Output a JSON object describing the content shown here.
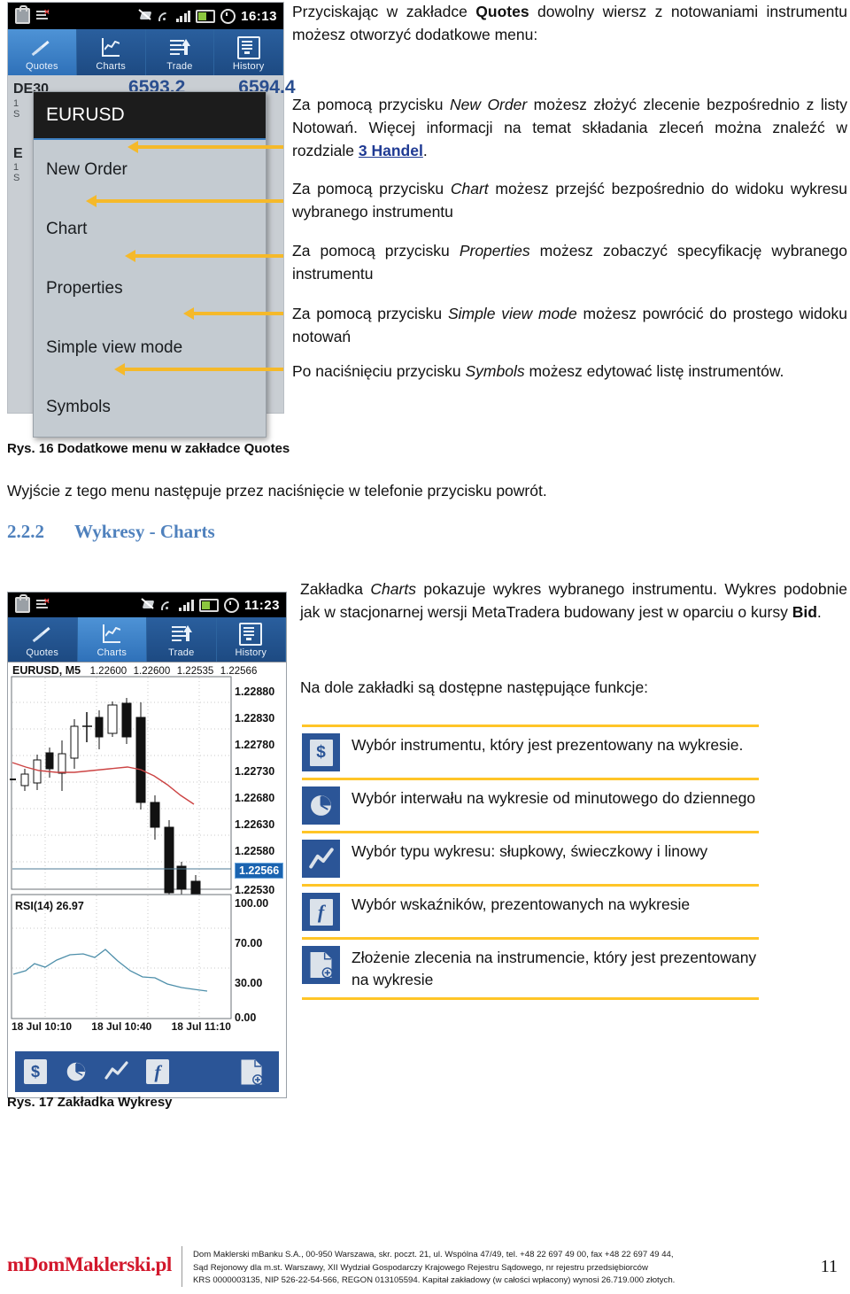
{
  "figure16": {
    "status_bar": {
      "time": "16:13",
      "icons": [
        "briefcase-icon",
        "tasklist-error-icon",
        "sync-off-icon",
        "wifi-icon",
        "signal-icon",
        "battery-icon",
        "alarm-icon"
      ]
    },
    "tabs": [
      {
        "label": "Quotes",
        "icon": "arrows-icon",
        "active": true
      },
      {
        "label": "Charts",
        "icon": "linechart-icon",
        "active": false
      },
      {
        "label": "Trade",
        "icon": "trade-icon",
        "active": false
      },
      {
        "label": "History",
        "icon": "history-icon",
        "active": false
      }
    ],
    "quotes": [
      {
        "symbol": "DE30",
        "bid": "6593.2",
        "ask": "6594.4",
        "sub_left": "1",
        "sub_left2": "S"
      },
      {
        "symbol": "E",
        "bid": "",
        "ask": "",
        "sub_left": "1",
        "sub_left2": "S"
      }
    ],
    "context_menu": {
      "title": "EURUSD",
      "items": [
        "New Order",
        "Chart",
        "Properties",
        "Simple view mode",
        "Symbols"
      ]
    }
  },
  "body": {
    "intro": {
      "p1_a": "Przyciskając w zakładce ",
      "p1_b": "Quotes",
      "p1_c": " dowolny wiersz z notowaniami instrumentu możesz otworzyć dodatkowe menu:"
    },
    "paragraphs": [
      {
        "a": "Za pomocą przycisku ",
        "em": "New Order",
        "b": " możesz złożyć zlecenie bezpośrednio z listy Notowań. Więcej informacji na temat składania zleceń można znaleźć w rozdziale ",
        "link": "3 Handel",
        "c": "."
      },
      {
        "a": "Za pomocą przycisku ",
        "em": "Chart",
        "b": " możesz przejść bezpośrednio do widoku wykresu wybranego instrumentu",
        "link": "",
        "c": ""
      },
      {
        "a": "Za pomocą przycisku ",
        "em": "Properties",
        "b": " możesz zobaczyć specyfikację wybranego instrumentu",
        "link": "",
        "c": ""
      },
      {
        "a": "Za pomocą przycisku ",
        "em": "Simple view mode",
        "b": " możesz powrócić do prostego widoku notowań",
        "link": "",
        "c": ""
      },
      {
        "a": "Po naciśnięciu przycisku ",
        "em": "Symbols",
        "b": " możesz edytować listę instrumentów.",
        "link": "",
        "c": ""
      }
    ],
    "caption16": "Rys. 16 Dodatkowe menu w zakładce Quotes",
    "exit_note": "Wyjście z tego menu następuje przez naciśnięcie w telefonie przycisku powrót.",
    "heading": {
      "number": "2.2.2",
      "text": "Wykresy - Charts"
    },
    "charts_intro": {
      "a": "Zakładka ",
      "em": "Charts",
      "b": " pokazuje wykres wybranego instrumentu. Wykres podobnie jak w stacjonarnej wersji MetaTradera budowany jest w oparciu o kursy ",
      "strong": "Bid",
      "c": "."
    },
    "functions_intro": "Na dole zakładki są dostępne następujące funkcje:",
    "caption17": "Rys. 17 Zakładka Wykresy"
  },
  "figure17": {
    "status_bar": {
      "time": "11:23"
    },
    "tabs": [
      {
        "label": "Quotes",
        "active": false
      },
      {
        "label": "Charts",
        "active": true
      },
      {
        "label": "Trade",
        "active": false
      },
      {
        "label": "History",
        "active": false
      }
    ],
    "chart_header": {
      "symbol_period": "EURUSD, M5",
      "ohlc": [
        "1.22600",
        "1.22600",
        "1.22535",
        "1.22566"
      ]
    },
    "price_labels": [
      "1.22880",
      "1.22830",
      "1.22780",
      "1.22730",
      "1.22680",
      "1.22630",
      "1.22580",
      "1.22530"
    ],
    "current_price": "1.22566",
    "indicator_label": "RSI(14) 26.97",
    "indicator_levels": [
      "100.00",
      "70.00",
      "30.00",
      "0.00"
    ],
    "time_labels": [
      "18 Jul 10:10",
      "18 Jul 10:40",
      "18 Jul 11:10"
    ],
    "toolbar_buttons": [
      {
        "name": "symbol-button",
        "glyph": "$"
      },
      {
        "name": "timeframe-button",
        "glyph": "clock"
      },
      {
        "name": "charttype-button",
        "glyph": "zigzag"
      },
      {
        "name": "indicators-button",
        "glyph": "f"
      },
      {
        "name": "neworder-button",
        "glyph": "doc-plus"
      }
    ]
  },
  "features": [
    {
      "icon": "dollar-icon",
      "text": "Wybór instrumentu, który jest prezentowany na wykresie."
    },
    {
      "icon": "clock-icon",
      "text": "Wybór interwału na wykresie od minutowego do dziennego"
    },
    {
      "icon": "zigzag-icon",
      "text": "Wybór typu wykresu: słupkowy, świeczkowy i linowy"
    },
    {
      "icon": "function-icon",
      "text": "Wybór wskaźników, prezentowanych na wykresie"
    },
    {
      "icon": "doc-plus-icon",
      "text": "Złożenie zlecenia na instrumencie, który jest prezentowany na wykresie"
    }
  ],
  "footer": {
    "logo": "mDomMaklerski.pl",
    "lines": [
      "Dom Maklerski mBanku S.A., 00-950 Warszawa, skr. poczt. 21, ul. Wspólna 47/49, tel. +48 22 697 49 00, fax +48 22 697 49 44,",
      "Sąd Rejonowy dla m.st. Warszawy, XII Wydział Gospodarczy Krajowego Rejestru Sądowego, nr rejestru przedsiębiorców",
      "KRS 0000003135, NIP 526-22-54-566, REGON 013105594. Kapitał zakładowy (w całości wpłacony) wynosi 26.719.000 złotych."
    ],
    "page_number": "11"
  },
  "colors": {
    "accent_blue": "#2b5597",
    "tab_blue": "#2a5f9e",
    "highlight_yellow": "#ffc527",
    "heading_blue": "#4f81bd",
    "logo_red": "#d2182c"
  }
}
